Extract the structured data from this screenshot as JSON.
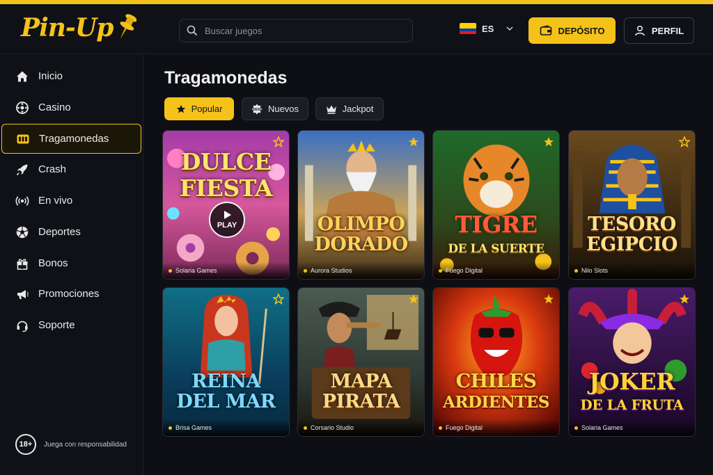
{
  "brand": {
    "name": "Pin-Up",
    "accent": "#f5c21a"
  },
  "header": {
    "search_placeholder": "Buscar juegos",
    "language": "ES",
    "deposit_label": "DEPÓSITO",
    "profile_label": "PERFIL"
  },
  "sidebar": {
    "items": [
      {
        "label": "Inicio",
        "icon": "home-icon"
      },
      {
        "label": "Casino",
        "icon": "roulette-icon"
      },
      {
        "label": "Tragamonedas",
        "icon": "slot-machine-icon",
        "active": true
      },
      {
        "label": "Crash",
        "icon": "rocket-icon"
      },
      {
        "label": "En vivo",
        "icon": "live-broadcast-icon"
      },
      {
        "label": "Deportes",
        "icon": "soccer-ball-icon"
      },
      {
        "label": "Bonos",
        "icon": "gift-icon"
      },
      {
        "label": "Promociones",
        "icon": "megaphone-icon"
      },
      {
        "label": "Soporte",
        "icon": "headset-icon"
      }
    ],
    "age_badge": "18+",
    "responsible_text": "Juega con responsabilidad"
  },
  "main": {
    "title": "Tragamonedas",
    "filters": [
      {
        "label": "Popular",
        "icon": "star-icon",
        "active": true
      },
      {
        "label": "Nuevos",
        "icon": "new-badge-icon",
        "active": false
      },
      {
        "label": "Jackpot",
        "icon": "crown-icon",
        "active": false
      }
    ],
    "games": [
      {
        "title_line1": "DULCE",
        "title_line2": "FIESTA",
        "provider": "Solaria Games",
        "play_label": "PLAY"
      },
      {
        "title_line1": "OLIMPO",
        "title_line2": "DORADO",
        "provider": "Aurora Studios"
      },
      {
        "title_line1": "TIGRE",
        "title_line2": "DE LA SUERTE",
        "provider": "Fuego Digital"
      },
      {
        "title_line1": "TESORO",
        "title_line2": "EGIPCIO",
        "provider": "Nilo Slots"
      },
      {
        "title_line1": "REINA",
        "title_line2": "DEL MAR",
        "provider": "Brisa Games"
      },
      {
        "title_line1": "MAPA",
        "title_line2": "PIRATA",
        "provider": "Corsario Studio"
      },
      {
        "title_line1": "CHILES",
        "title_line2": "ARDIENTES",
        "provider": "Fuego Digital"
      },
      {
        "title_line1": "JOKER",
        "title_line2": "DE LA FRUTA",
        "provider": "Solaria Games"
      }
    ]
  }
}
